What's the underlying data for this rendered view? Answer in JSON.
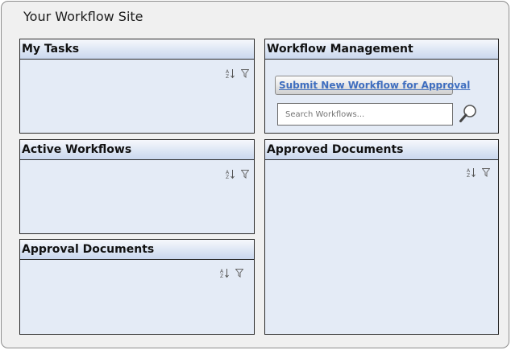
{
  "site": {
    "title": "Your Workflow Site"
  },
  "panels": {
    "my_tasks": {
      "title": "My Tasks"
    },
    "active_workflows": {
      "title": "Active Workflows"
    },
    "approval_documents": {
      "title": "Approval Documents"
    },
    "workflow_management": {
      "title": "Workflow Management",
      "submit_label": "Submit New Workflow for Approval",
      "search_placeholder": "Search Workflows..."
    },
    "approved_documents": {
      "title": "Approved Documents"
    }
  },
  "icons": {
    "sort": "sort-az-icon",
    "filter": "filter-funnel-icon",
    "search": "magnifier-icon"
  },
  "colors": {
    "panel_bg": "#e4ebf6",
    "header_bg": "#c9d7ee",
    "link": "#3f6ebf",
    "frame_bg": "#f0f0f0"
  }
}
